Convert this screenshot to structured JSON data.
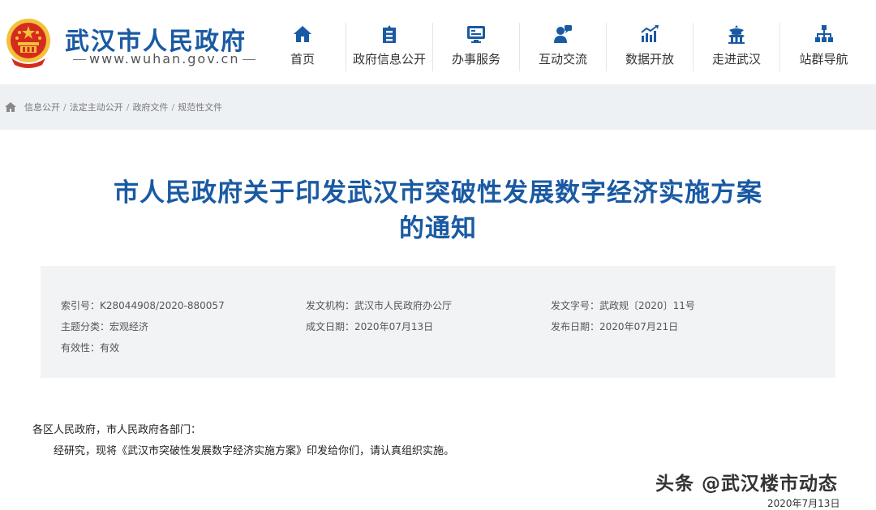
{
  "header": {
    "site_title": "武汉市人民政府",
    "site_url": "www.wuhan.gov.cn",
    "nav": [
      {
        "label": "首页",
        "icon": "home-icon"
      },
      {
        "label": "政府信息公开",
        "icon": "government-info-icon"
      },
      {
        "label": "办事服务",
        "icon": "service-icon"
      },
      {
        "label": "互动交流",
        "icon": "interaction-icon"
      },
      {
        "label": "数据开放",
        "icon": "data-chart-icon"
      },
      {
        "label": "走进武汉",
        "icon": "pavilion-icon"
      },
      {
        "label": "站群导航",
        "icon": "sitemap-icon"
      }
    ],
    "colors": {
      "brand": "#1a5aa3",
      "emblem_red": "#d52b1e",
      "emblem_gold": "#f3c13a"
    }
  },
  "breadcrumb": [
    "信息公开",
    "法定主动公开",
    "政府文件",
    "规范性文件"
  ],
  "document": {
    "title_line1": "市人民政府关于印发武汉市突破性发展数字经济实施方案",
    "title_line2": "的通知",
    "meta": {
      "index_no": {
        "key": "索引号",
        "value": "K28044908/2020-880057"
      },
      "issuer": {
        "key": "发文机构",
        "value": "武汉市人民政府办公厅"
      },
      "doc_no": {
        "key": "发文字号",
        "value": "武政规〔2020〕11号"
      },
      "category": {
        "key": "主题分类",
        "value": "宏观经济"
      },
      "created": {
        "key": "成文日期",
        "value": "2020年07月13日"
      },
      "published": {
        "key": "发布日期",
        "value": "2020年07月21日"
      },
      "validity": {
        "key": "有效性",
        "value": "有效"
      }
    },
    "salutation": "各区人民政府，市人民政府各部门：",
    "paragraph": "经研究，现将《武汉市突破性发展数字经济实施方案》印发给你们，请认真组织实施。"
  },
  "watermark": {
    "text": "头条 @武汉楼市动态",
    "date": "2020年7月13日"
  }
}
